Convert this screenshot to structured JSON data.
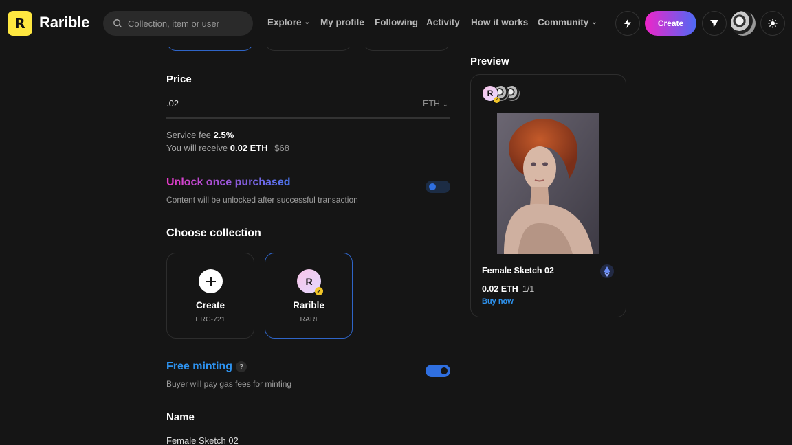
{
  "header": {
    "brand": "Rarible",
    "logo_letter": "R",
    "search_placeholder": "Collection, item or user",
    "nav": [
      "Explore",
      "My profile",
      "Following",
      "Activity",
      "How it works",
      "Community"
    ],
    "create_label": "Create"
  },
  "form": {
    "price_label": "Price",
    "price_value": ".02",
    "currency": "ETH",
    "service_fee_label": "Service fee",
    "service_fee_value": "2.5%",
    "receive_label": "You will receive",
    "receive_value": "0.02 ETH",
    "receive_usd": "$68",
    "unlock_title": "Unlock once purchased",
    "unlock_desc": "Content will be unlocked after successful transaction",
    "unlock_on": false,
    "collection_title": "Choose collection",
    "collections": [
      {
        "name": "Create",
        "sub": "ERC-721"
      },
      {
        "name": "Rarible",
        "sub": "RARI",
        "letter": "R",
        "selected": true
      }
    ],
    "free_minting_title": "Free minting",
    "free_minting_help": "?",
    "free_minting_desc": "Buyer will pay gas fees for minting",
    "free_minting_on": true,
    "name_label": "Name",
    "name_value": "Female Sketch 02"
  },
  "preview": {
    "title": "Preview",
    "avatar_letter": "R",
    "nft_name": "Female Sketch 02",
    "price": "0.02 ETH",
    "edition": "1/1",
    "buy_label": "Buy now"
  },
  "colors": {
    "accent_blue": "#2e93f0",
    "toggle_blue": "#2f6fe0",
    "create_gradient_start": "#f024c8",
    "create_gradient_end": "#4d6af5"
  }
}
